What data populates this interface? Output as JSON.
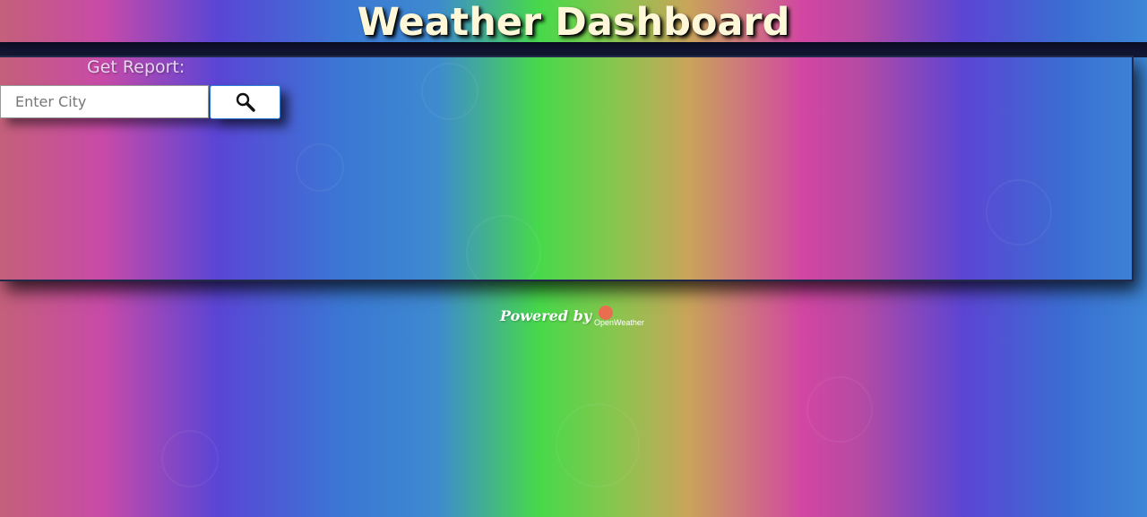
{
  "header": {
    "title": "Weather Dashboard"
  },
  "search": {
    "heading": "Get Report:",
    "placeholder": "Enter City",
    "value": "",
    "button_icon": "search-icon"
  },
  "footer": {
    "powered_by": "Powered by",
    "logo_text": "OpenWeather"
  },
  "colors": {
    "title": "#fff8d8",
    "button_border": "#2f7fd8",
    "logo_dot": "#e96e50"
  }
}
